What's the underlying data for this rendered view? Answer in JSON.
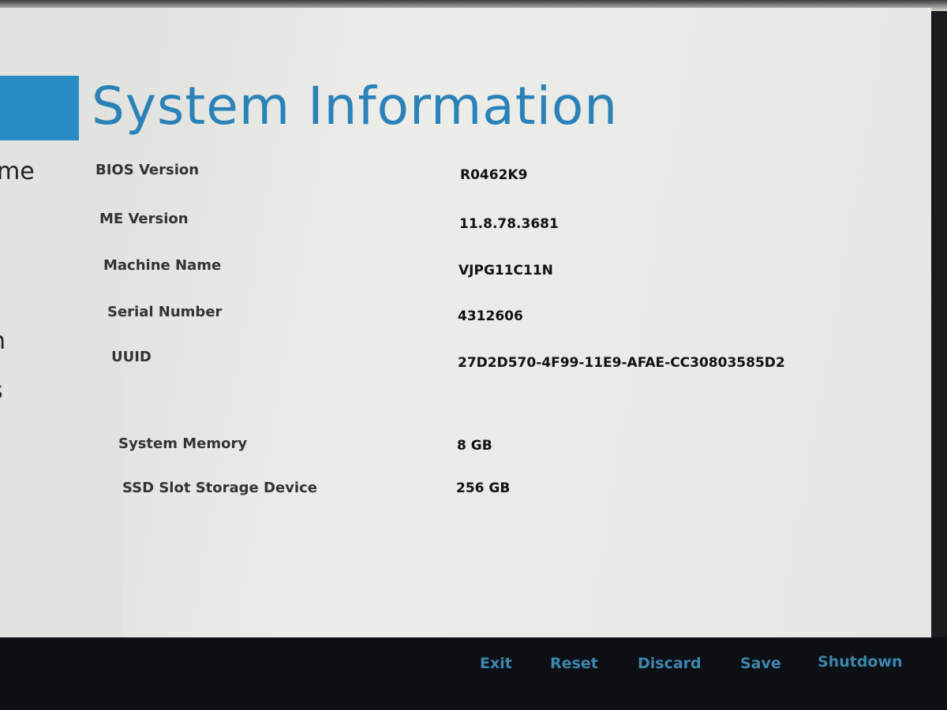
{
  "title": "System Information",
  "sidebar": {
    "items": [
      "me",
      "n",
      "s"
    ]
  },
  "info": [
    {
      "label": "BIOS Version",
      "value": "R0462K9"
    },
    {
      "label": "ME Version",
      "value": "11.8.78.3681"
    },
    {
      "label": "Machine Name",
      "value": "VJPG11C11N"
    },
    {
      "label": "Serial Number",
      "value": "4312606"
    },
    {
      "label": "UUID",
      "value": "27D2D570-4F99-11E9-AFAE-CC30803585D2"
    },
    {
      "label": "System Memory",
      "value": "8 GB"
    },
    {
      "label": "SSD Slot Storage Device",
      "value": "256 GB"
    }
  ],
  "footer": {
    "buttons": [
      "Exit",
      "Reset",
      "Discard",
      "Save",
      "Shutdown"
    ]
  },
  "colors": {
    "accent": "#2a8cc4",
    "button_text": "#3d86ad",
    "footer_bg": "#0c0f14"
  }
}
